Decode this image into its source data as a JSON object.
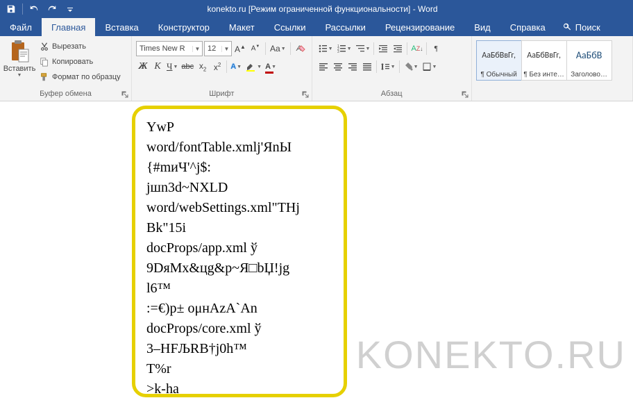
{
  "titlebar": {
    "title": "konekto.ru [Режим ограниченной функциональности]  -  Word"
  },
  "tabs": {
    "file": "Файл",
    "home": "Главная",
    "insert": "Вставка",
    "design": "Конструктор",
    "layout": "Макет",
    "references": "Ссылки",
    "mailings": "Рассылки",
    "review": "Рецензирование",
    "view": "Вид",
    "help": "Справка",
    "search": "Поиск"
  },
  "clipboard": {
    "paste": "Вставить",
    "cut": "Вырезать",
    "copy": "Копировать",
    "format_painter": "Формат по образцу",
    "group": "Буфер обмена"
  },
  "font": {
    "name": "Times New R",
    "size": "12",
    "group": "Шрифт"
  },
  "paragraph": {
    "group": "Абзац"
  },
  "styles": {
    "preview": "АаБбВвГг,",
    "normal": "¶ Обычный",
    "no_spacing": "¶ Без инте…",
    "heading1_preview": "АаБбВ",
    "heading1": "Заголово…"
  },
  "document_lines": [
    "YwP",
    "word/fontTable.xmlj'ЯnЫ",
    "{#mиЧ'^j$:",
    "jшn3d~NXLD",
    "word/webSettings.xml\"THj",
    "Bk\"15i",
    "docProps/app.xml ў",
    "9DяMx&цg&p~Я□bЏ!jg",
    "l6™",
    ":=€)p± oμнAzA`An",
    "docProps/core.xml ў",
    "3–HFЉRB†j0h™",
    "T%r",
    ">k-ha"
  ],
  "watermark": "KONEKTO.RU"
}
